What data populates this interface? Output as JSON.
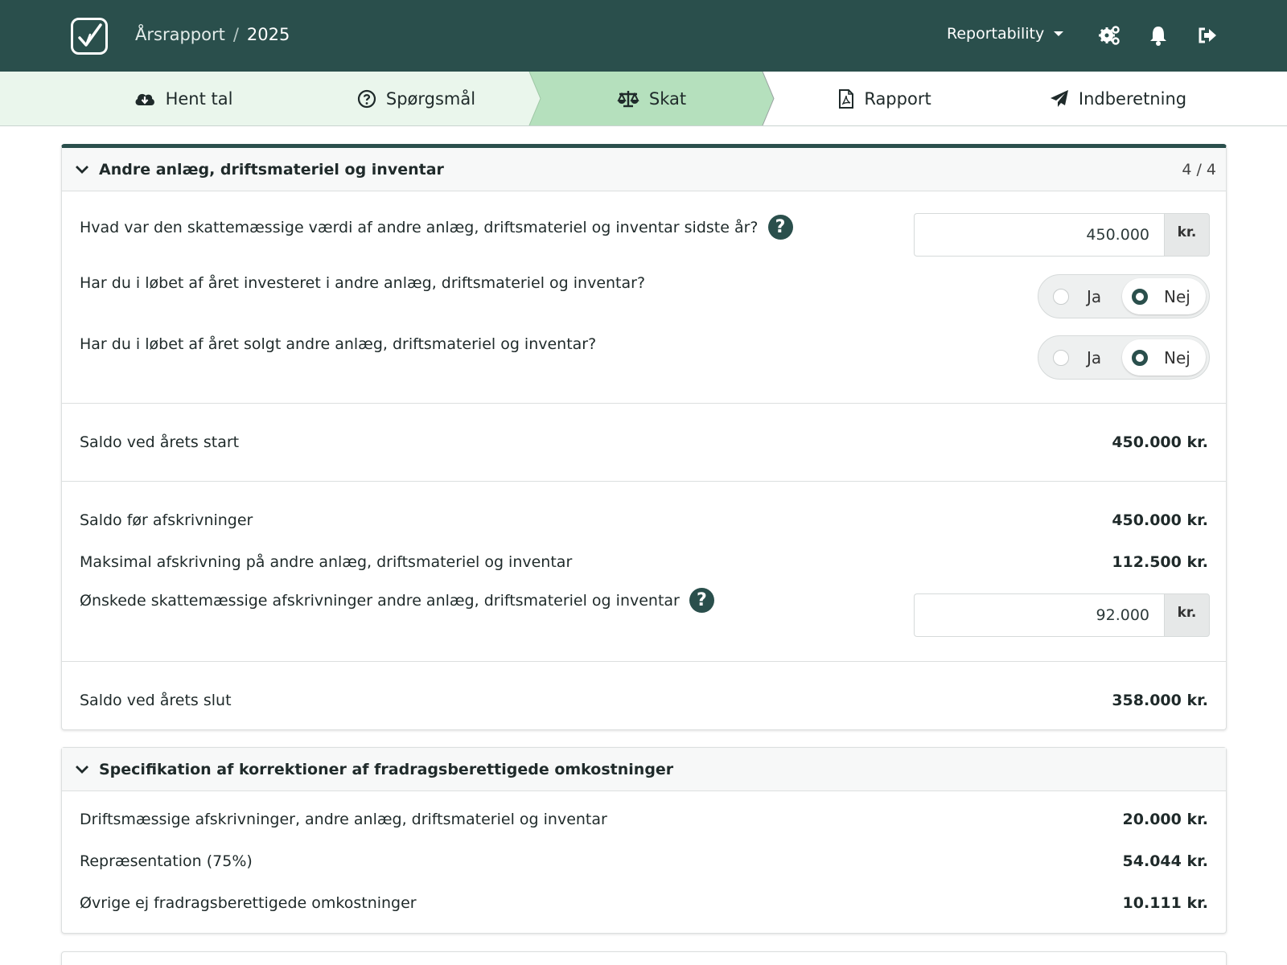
{
  "header": {
    "breadcrumb_root": "Årsrapport",
    "breadcrumb_sep": "/",
    "breadcrumb_year": "2025",
    "org_name": "Reportability",
    "icons": [
      "check-logo-icon",
      "settings-gears-icon",
      "bell-icon",
      "sign-out-icon"
    ]
  },
  "steps": [
    {
      "label": "Hent tal",
      "icon": "cloud-download-icon"
    },
    {
      "label": "Spørgsmål",
      "icon": "question-circle-icon"
    },
    {
      "label": "Skat",
      "icon": "balance-scale-icon",
      "active": true
    },
    {
      "label": "Rapport",
      "icon": "file-pdf-icon"
    },
    {
      "label": "Indberetning",
      "icon": "paper-plane-icon"
    }
  ],
  "section1": {
    "title": "Andre anlæg, driftsmateriel og inventar",
    "count": "4 / 4",
    "q1": {
      "text": "Hvad var den skattemæssige værdi af andre anlæg, driftsmateriel og inventar sidste år?",
      "value": "450.000",
      "suffix": "kr."
    },
    "q2": {
      "text": "Har du i løbet af året investeret i andre anlæg, driftsmateriel og inventar?",
      "yes": "Ja",
      "no": "Nej",
      "selected": "Nej"
    },
    "q3": {
      "text": "Har du i løbet af året solgt andre anlæg, driftsmateriel og inventar?",
      "yes": "Ja",
      "no": "Nej",
      "selected": "Nej"
    },
    "saldo_start": {
      "label": "Saldo ved årets start",
      "value": "450.000 kr."
    },
    "saldo_before": {
      "label": "Saldo før afskrivninger",
      "value": "450.000 kr."
    },
    "max_depr": {
      "label": "Maksimal afskrivning på andre anlæg, driftsmateriel og inventar",
      "value": "112.500 kr."
    },
    "wanted_depr": {
      "label": "Ønskede skattemæssige afskrivninger andre anlæg, driftsmateriel og inventar",
      "value": "92.000",
      "suffix": "kr."
    },
    "saldo_end": {
      "label": "Saldo ved årets slut",
      "value": "358.000 kr."
    }
  },
  "section2": {
    "title": "Specifikation af korrektioner af fradragsberettigede omkostninger",
    "rows": [
      {
        "label": "Driftsmæssige afskrivninger, andre anlæg, driftsmateriel og inventar",
        "value": "20.000 kr."
      },
      {
        "label": "Repræsentation (75%)",
        "value": "54.044 kr."
      },
      {
        "label": "Øvrige ej fradragsberettigede omkostninger",
        "value": "10.111 kr."
      }
    ]
  },
  "colors": {
    "brand": "#2a4f4c",
    "step_bg": "#eaf6ec",
    "step_active": "#b5e0bd"
  }
}
